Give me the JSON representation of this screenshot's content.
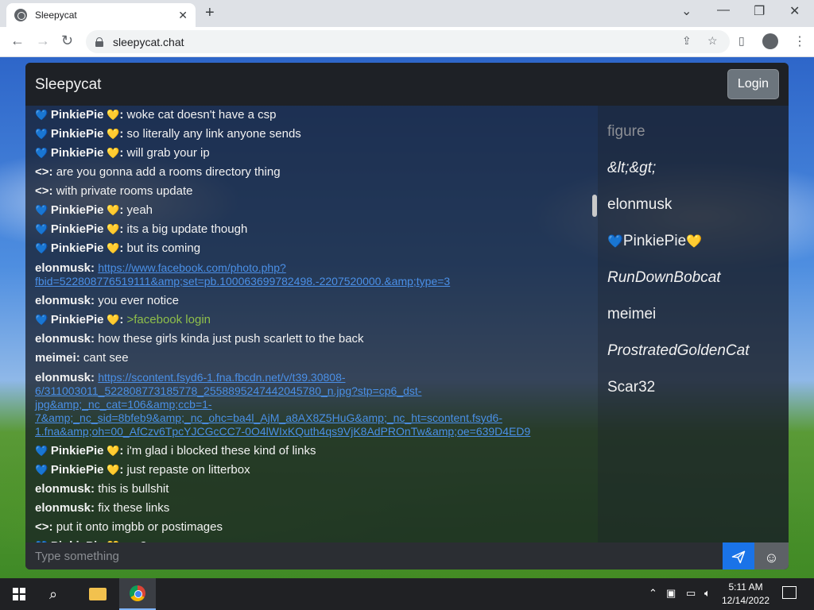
{
  "browser": {
    "tab_title": "Sleepycat",
    "url": "sleepycat.chat",
    "tab_close": "✕",
    "new_tab": "+"
  },
  "app": {
    "title": "Sleepycat",
    "login_label": "Login",
    "input_placeholder": "Type something"
  },
  "messages": [
    {
      "user": "PinkiePie",
      "badge": true,
      "text": "woke cat doesn't have a csp"
    },
    {
      "user": "PinkiePie",
      "badge": true,
      "text": "so literally any link anyone sends"
    },
    {
      "user": "PinkiePie",
      "badge": true,
      "text": "will grab your ip"
    },
    {
      "user": "<>",
      "badge": false,
      "text": "are you gonna add a rooms directory thing"
    },
    {
      "user": "<>",
      "badge": false,
      "text": "with private rooms update"
    },
    {
      "user": "PinkiePie",
      "badge": true,
      "text": "yeah"
    },
    {
      "user": "PinkiePie",
      "badge": true,
      "text": "its a big update though"
    },
    {
      "user": "PinkiePie",
      "badge": true,
      "text": "but its coming"
    },
    {
      "user": "elonmusk",
      "badge": false,
      "link": "https://www.facebook.com/photo.php?fbid=522808776519111&amp;set=pb.100063699782498.-2207520000.&amp;type=3"
    },
    {
      "user": "elonmusk",
      "badge": false,
      "text": "you ever notice"
    },
    {
      "user": "PinkiePie",
      "badge": true,
      "greentext": ">facebook login"
    },
    {
      "user": "elonmusk",
      "badge": false,
      "text": "how these girls kinda just push scarlett to the back"
    },
    {
      "user": "meimei",
      "badge": false,
      "text": "cant see"
    },
    {
      "user": "elonmusk",
      "badge": false,
      "link": "https://scontent.fsyd6-1.fna.fbcdn.net/v/t39.30808-6/311003011_522808773185778_2558895247442045780_n.jpg?stp=cp6_dst-jpg&amp;_nc_cat=106&amp;ccb=1-7&amp;_nc_sid=8bfeb9&amp;_nc_ohc=ba4l_AjM_a8AX8Z5HuG&amp;_nc_ht=scontent.fsyd6-1.fna&amp;oh=00_AfCzv6TpcYJCGcCC7-0O4lWIxKQuth4qs9VjK8AdPROnTw&amp;oe=639D4ED9"
    },
    {
      "user": "PinkiePie",
      "badge": true,
      "text": "i'm glad i blocked these kind of links"
    },
    {
      "user": "PinkiePie",
      "badge": true,
      "text": "just repaste on litterbox"
    },
    {
      "user": "elonmusk",
      "badge": false,
      "text": "this is bullshit"
    },
    {
      "user": "elonmusk",
      "badge": false,
      "text": "fix these links"
    },
    {
      "user": "<>",
      "badge": false,
      "text": "put it onto imgbb or postimages"
    },
    {
      "user": "PinkiePie",
      "badge": true,
      "text": "no?"
    }
  ],
  "users": [
    {
      "name": "figure",
      "style": "dim"
    },
    {
      "name": "&lt;&gt;",
      "style": "italic"
    },
    {
      "name": "elonmusk",
      "style": "normal"
    },
    {
      "name": "PinkiePie",
      "style": "badge"
    },
    {
      "name": "RunDownBobcat",
      "style": "italic"
    },
    {
      "name": "meimei",
      "style": "normal"
    },
    {
      "name": "ProstratedGoldenCat",
      "style": "italic"
    },
    {
      "name": "Scar32",
      "style": "normal"
    }
  ],
  "taskbar": {
    "time": "5:11 AM",
    "date": "12/14/2022"
  },
  "colors": {
    "send_button": "#1a73e8",
    "link": "#4a8fe6",
    "greentext": "#8fbf4a"
  }
}
